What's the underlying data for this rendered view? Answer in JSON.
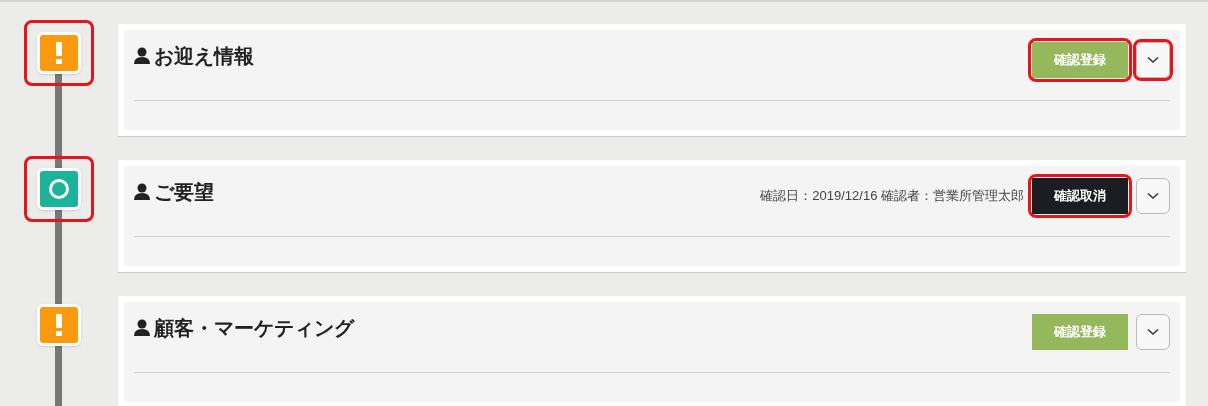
{
  "sections": [
    {
      "title": "お迎え情報",
      "status_marker": {
        "kind": "pending",
        "highlighted": true
      },
      "action": {
        "kind": "register",
        "label": "確認登録",
        "highlighted": true
      },
      "expand_highlighted": true
    },
    {
      "title": "ご要望",
      "status_marker": {
        "kind": "confirmed",
        "highlighted": true
      },
      "confirmation": "確認日：2019/12/16 確認者：営業所管理太郎",
      "action": {
        "kind": "cancel",
        "label": "確認取消",
        "highlighted": true
      },
      "expand_highlighted": false
    },
    {
      "title": "顧客・マーケティング",
      "status_marker": {
        "kind": "pending",
        "highlighted": false
      },
      "action": {
        "kind": "register",
        "label": "確認登録",
        "highlighted": false
      },
      "expand_highlighted": false
    }
  ]
}
